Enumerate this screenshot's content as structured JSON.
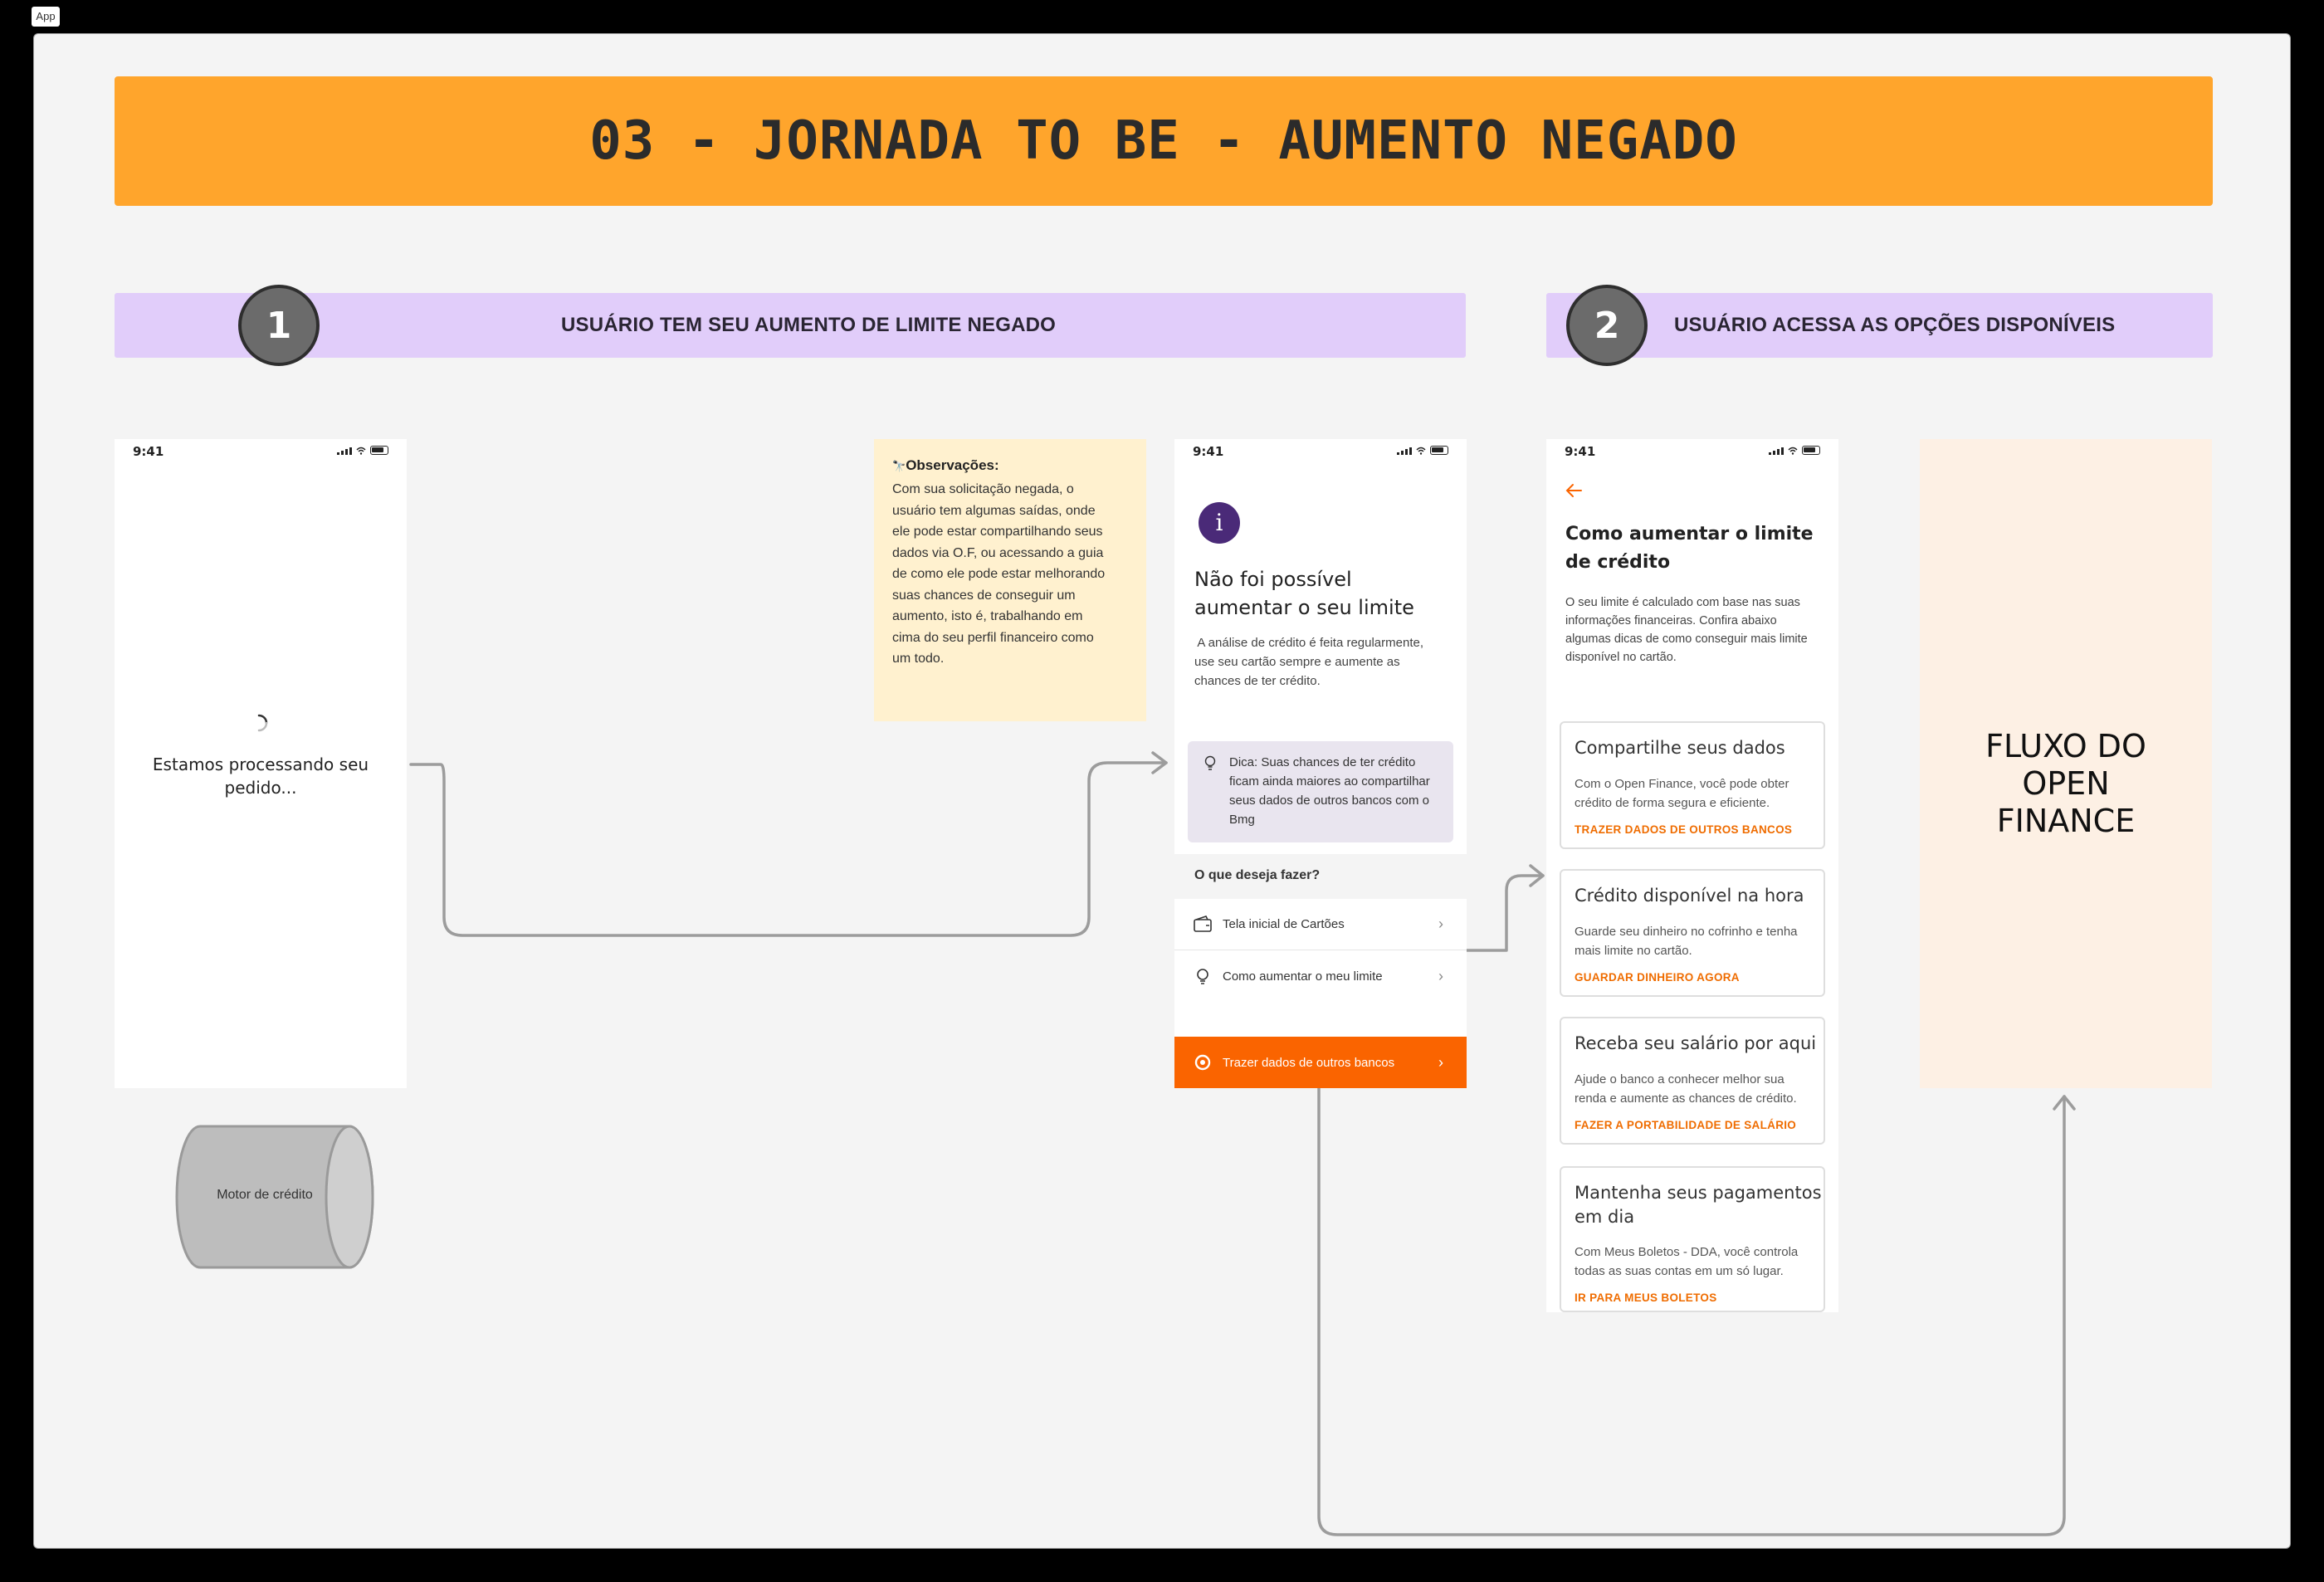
{
  "app_tag": "App",
  "banner": {
    "title": "03 - JORNADA TO BE - AUMENTO NEGADO"
  },
  "stages": [
    {
      "number": "1",
      "title": "USUÁRIO TEM SEU AUMENTO DE LIMITE NEGADO"
    },
    {
      "number": "2",
      "title": "USUÁRIO ACESSA AS OPÇÕES DISPONÍVEIS"
    }
  ],
  "screen_loading": {
    "time": "9:41",
    "message_line1": "Estamos processando seu",
    "message_line2": "pedido..."
  },
  "motor": {
    "label": "Motor de crédito"
  },
  "observacoes": {
    "title": "Observações:",
    "lines": [
      "Com sua solicitação negada, o",
      "usuário tem algumas saídas, onde",
      "ele pode estar compartilhando seus",
      "dados via O.F, ou acessando a guia",
      "de como ele pode estar melhorando",
      "suas chances de conseguir um",
      "aumento, isto é, trabalhando em",
      "cima do seu perfil financeiro como",
      "um todo."
    ]
  },
  "screen_denied": {
    "time": "9:41",
    "icon_letter": "i",
    "title_line1": "Não foi possível",
    "title_line2": "aumentar o seu limite",
    "desc_lines": [
      " A análise de crédito é feita regularmente,",
      "use seu cartão sempre e aumente as",
      "chances de ter crédito."
    ],
    "tip_lines": [
      "Dica: Suas chances de ter crédito",
      "ficam ainda maiores ao compartilhar",
      "seus dados de outros bancos com o",
      "Bmg"
    ],
    "question": "O que deseja fazer?",
    "options": [
      {
        "label": "Tela inicial de Cartões",
        "icon": "wallet-icon"
      },
      {
        "label": "Como aumentar o meu limite",
        "icon": "lightbulb-icon"
      },
      {
        "label": "Trazer dados de outros bancos",
        "icon": "open-finance-icon"
      }
    ],
    "accent": "#fa6400"
  },
  "screen_options": {
    "time": "9:41",
    "title_line1": "Como aumentar o limite",
    "title_line2": "de crédito",
    "desc_lines": [
      "O seu limite é calculado com base nas suas",
      "informações financeiras. Confira abaixo",
      "algumas dicas de como conseguir mais limite",
      "disponível no cartão."
    ],
    "cards": [
      {
        "title_lines": [
          "Compartilhe seus dados"
        ],
        "body_lines": [
          "Com o Open Finance, você pode obter",
          "crédito de forma segura e eficiente."
        ],
        "link": "TRAZER DADOS DE OUTROS BANCOS"
      },
      {
        "title_lines": [
          "Crédito disponível na hora"
        ],
        "body_lines": [
          "Guarde seu dinheiro no cofrinho e tenha",
          "mais limite no cartão."
        ],
        "link": "GUARDAR DINHEIRO AGORA"
      },
      {
        "title_lines": [
          "Receba seu salário por aqui"
        ],
        "body_lines": [
          "Ajude o banco a conhecer melhor sua",
          "renda e aumente as chances de crédito."
        ],
        "link": "FAZER A PORTABILIDADE DE SALÁRIO"
      },
      {
        "title_lines": [
          "Mantenha seus pagamentos",
          "em dia"
        ],
        "body_lines": [
          "Com Meus Boletos - DDA, você controla",
          "todas as suas contas em um só lugar."
        ],
        "link": "IR PARA MEUS BOLETOS"
      }
    ]
  },
  "open_finance": {
    "lines": [
      "FLUXO DO",
      "OPEN",
      "FINANCE"
    ]
  },
  "colors": {
    "banner": "#ffa52c",
    "stage": "#e1cdfa",
    "accent": "#fa6400",
    "note": "#fff1cf",
    "open_finance_bg": "#fdf0e4"
  }
}
